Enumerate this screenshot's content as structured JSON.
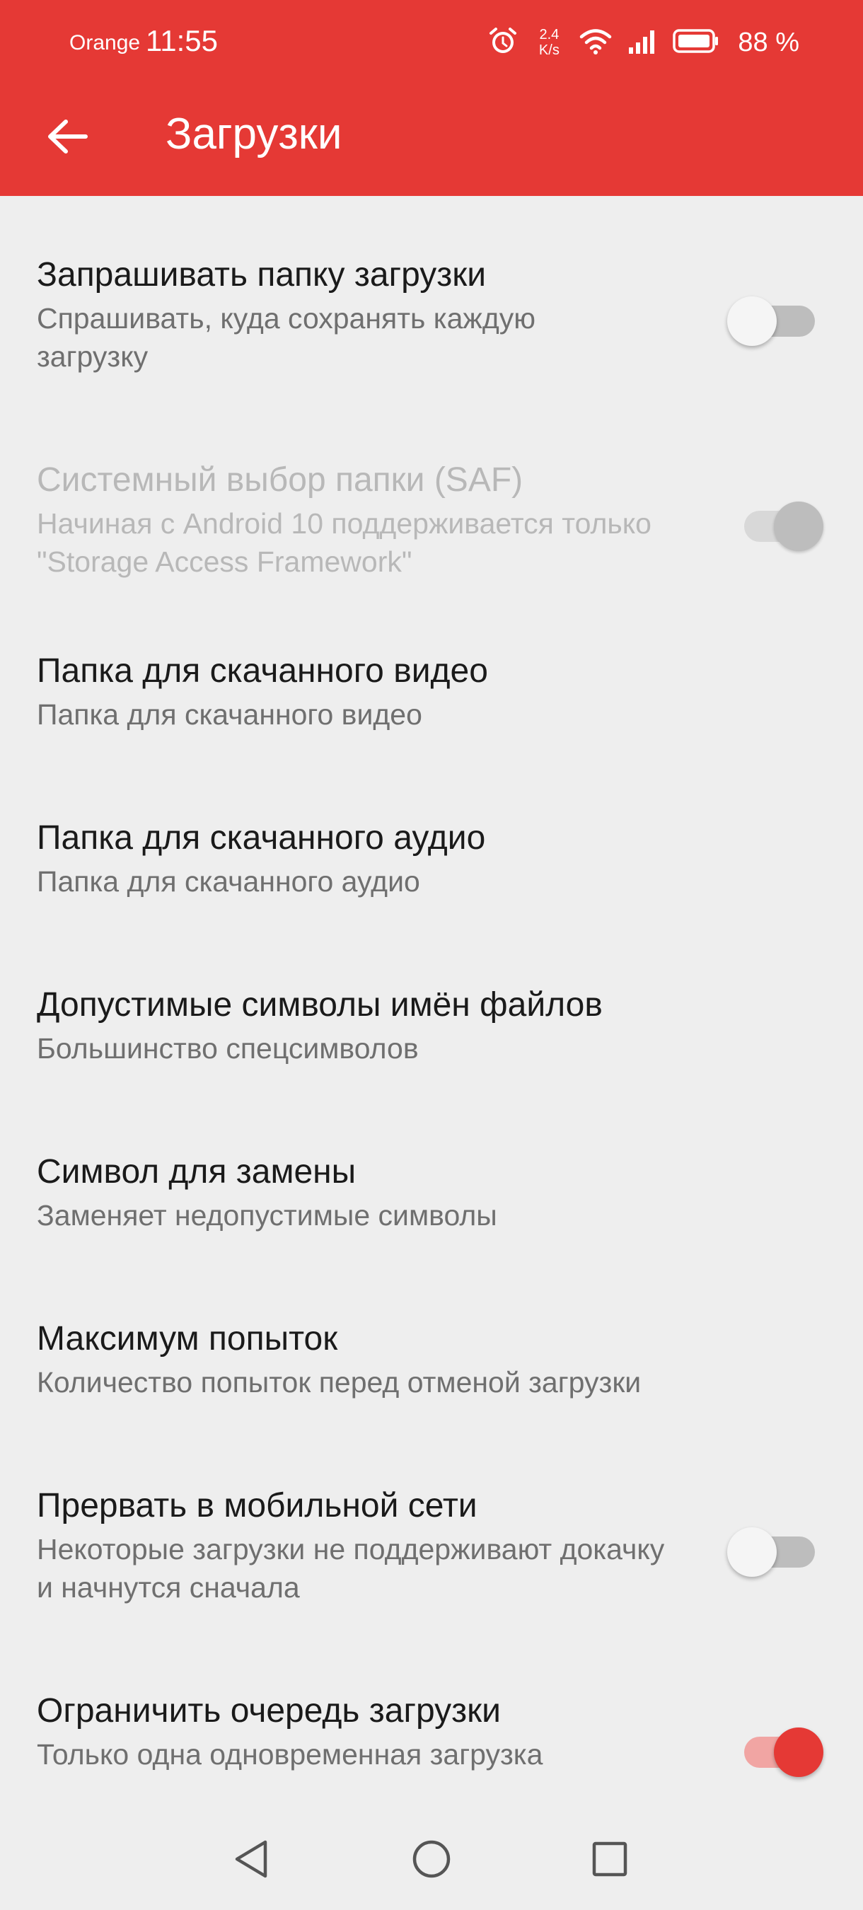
{
  "status_bar": {
    "carrier": "Orange",
    "time": "11:55",
    "net_speed_value": "2.4",
    "net_speed_unit": "K/s",
    "battery": "88 %",
    "icons": [
      "alarm-icon",
      "wifi-icon",
      "signal-icon",
      "battery-icon"
    ]
  },
  "app_bar": {
    "title": "Загрузки",
    "back_icon": "arrow-left-icon"
  },
  "settings": [
    {
      "title": "Запрашивать папку загрузки",
      "summary": "Спрашивать, куда сохранять каждую загрузку",
      "switch": "off"
    },
    {
      "title": "Системный выбор папки (SAF)",
      "summary": "Начиная с Android 10 поддерживается только \"Storage Access Framework\"",
      "switch": "on-disabled"
    },
    {
      "title": "Папка для скачанного видео",
      "summary": "Папка для скачанного видео"
    },
    {
      "title": "Папка для скачанного аудио",
      "summary": "Папка для скачанного аудио"
    },
    {
      "title": "Допустимые символы имён файлов",
      "summary": "Большинство спецсимволов"
    },
    {
      "title": "Символ для замены",
      "summary": "Заменяет недопустимые символы"
    },
    {
      "title": "Максимум попыток",
      "summary": "Количество попыток перед отменой загрузки"
    },
    {
      "title": "Прервать в мобильной сети",
      "summary": "Некоторые загрузки не поддерживают докачку и начнутся сначала",
      "switch": "off"
    },
    {
      "title": "Ограничить очередь загрузки",
      "summary": "Только одна одновременная загрузка",
      "switch": "on"
    }
  ],
  "nav_bar": {
    "icons": [
      "back-triangle-icon",
      "home-circle-icon",
      "recents-square-icon"
    ]
  },
  "colors": {
    "accent": "#e53935",
    "background": "#eeeeee"
  }
}
